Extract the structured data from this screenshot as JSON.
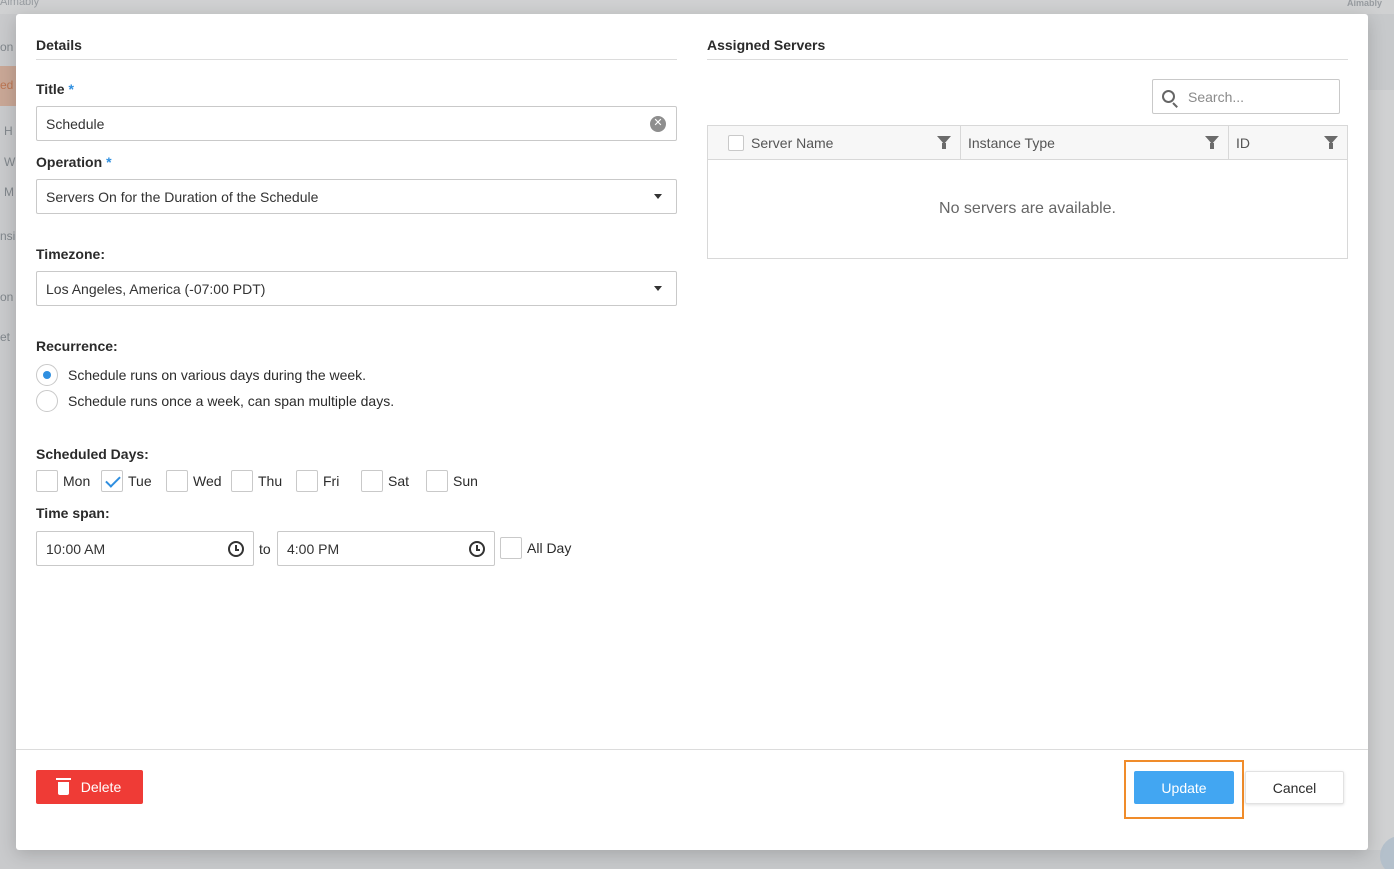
{
  "background": {
    "logo_left": "Aimably",
    "logo_right": "Aimably",
    "sidebar_fragments": [
      "on",
      "ed",
      "H",
      "W",
      "M",
      "nsi",
      "on",
      "et"
    ]
  },
  "details": {
    "section_title": "Details",
    "title_label": "Title",
    "title_value": "Schedule",
    "operation_label": "Operation",
    "operation_value": "Servers On for the Duration of the Schedule",
    "required_mark": "*",
    "timezone_label": "Timezone:",
    "timezone_value": "Los Angeles, America (-07:00 PDT)",
    "recurrence_label": "Recurrence:",
    "recurrence_options": [
      {
        "label": "Schedule runs on various days during the week.",
        "selected": true
      },
      {
        "label": "Schedule runs once a week, can span multiple days.",
        "selected": false
      }
    ],
    "scheduled_days_label": "Scheduled Days:",
    "days": [
      {
        "label": "Mon",
        "checked": false
      },
      {
        "label": "Tue",
        "checked": true
      },
      {
        "label": "Wed",
        "checked": false
      },
      {
        "label": "Thu",
        "checked": false
      },
      {
        "label": "Fri",
        "checked": false
      },
      {
        "label": "Sat",
        "checked": false
      },
      {
        "label": "Sun",
        "checked": false
      }
    ],
    "timespan_label": "Time span:",
    "start_time": "10:00 AM",
    "to_label": "to",
    "end_time": "4:00 PM",
    "all_day_label": "All Day",
    "all_day_checked": false
  },
  "servers": {
    "section_title": "Assigned Servers",
    "search_placeholder": "Search...",
    "columns": [
      "Server Name",
      "Instance Type",
      "ID"
    ],
    "empty_message": "No servers are available."
  },
  "footer": {
    "delete_label": "Delete",
    "update_label": "Update",
    "cancel_label": "Cancel"
  },
  "colors": {
    "accent": "#2f8fe0",
    "update": "#42a6f2",
    "delete": "#ef3b36",
    "focus": "#f08c2a"
  }
}
